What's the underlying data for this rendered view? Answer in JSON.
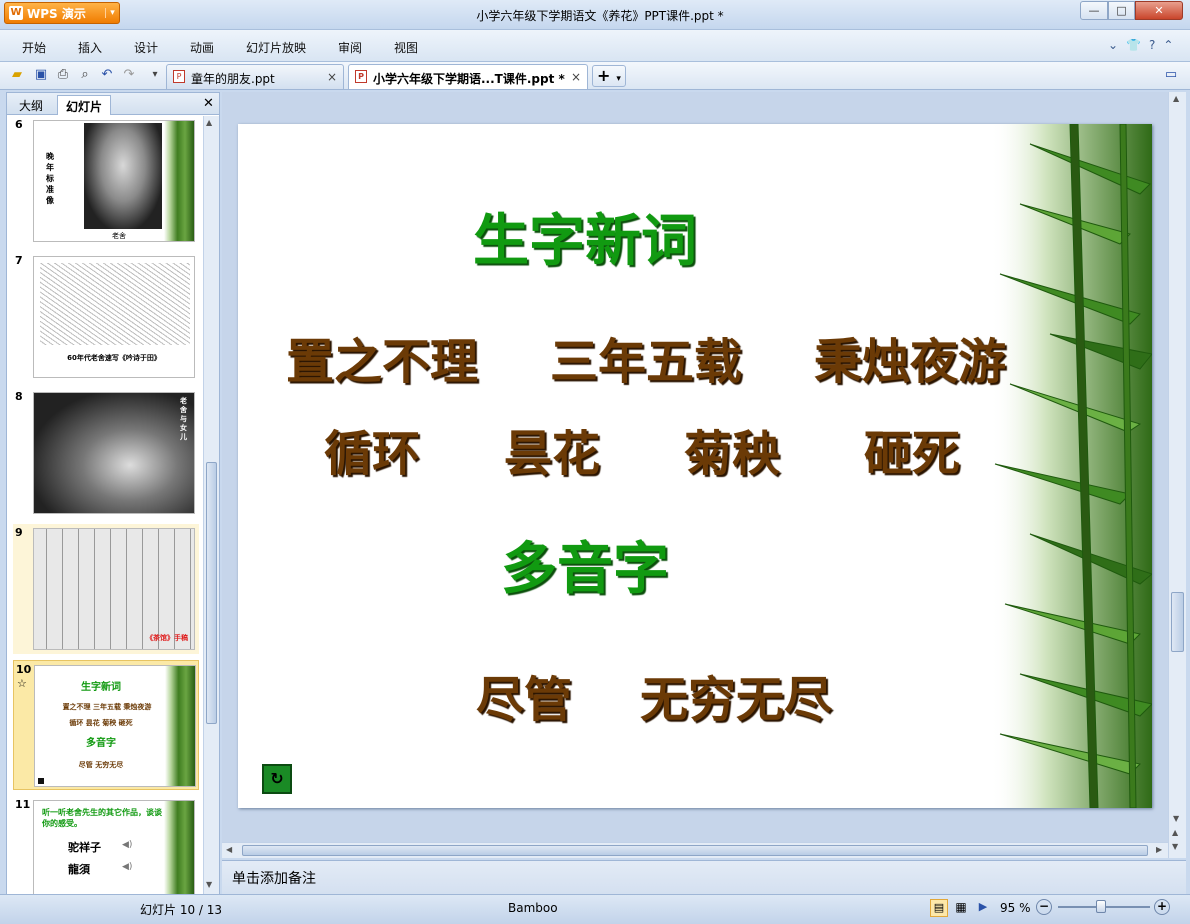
{
  "app": {
    "name": "WPS 演示"
  },
  "window": {
    "title": "小学六年级下学期语文《养花》PPT课件.ppt *",
    "min": "—",
    "max": "□",
    "close": "✕"
  },
  "menu": {
    "items": [
      "开始",
      "插入",
      "设计",
      "动画",
      "幻灯片放映",
      "审阅",
      "视图"
    ]
  },
  "doc_tabs": [
    {
      "label": "童年的朋友.ppt",
      "active": false
    },
    {
      "label": "小学六年级下学期语...T课件.ppt *",
      "active": true
    }
  ],
  "panel": {
    "tabs": [
      "大纲",
      "幻灯片"
    ],
    "thumbnails": [
      {
        "num": "6",
        "caption": "晚年标准像",
        "sub": "老舍"
      },
      {
        "num": "7",
        "caption": "60年代老舍速写《吟诗于田》"
      },
      {
        "num": "8",
        "caption": "老舍与女儿"
      },
      {
        "num": "9",
        "caption": "《茶馆》手稿"
      },
      {
        "num": "10",
        "title": "生字新词",
        "line1": "置之不理  三年五载  秉烛夜游",
        "line2": "循环  昙花  菊秧  砸死",
        "title2": "多音字",
        "line3": "尽管  无穷无尽"
      },
      {
        "num": "11",
        "caption": "听一听老舍先生的其它作品，谈谈你的感受。",
        "item1": "驼祥子",
        "item2": "龍須"
      }
    ]
  },
  "slide": {
    "heading1": "生字新词",
    "row1": [
      "置之不理",
      "三年五载",
      "秉烛夜游"
    ],
    "row2": [
      "循环",
      "昙花",
      "菊秧",
      "砸死"
    ],
    "heading2": "多音字",
    "row3": [
      "尽管",
      "无穷无尽"
    ]
  },
  "notes": {
    "placeholder": "单击添加备注"
  },
  "status": {
    "slide_pos": "幻灯片 10 / 13",
    "theme": "Bamboo",
    "zoom": "95 %"
  },
  "colors": {
    "heading": "#119a11",
    "words": "#6b3a06",
    "accent": "#f07c00"
  }
}
